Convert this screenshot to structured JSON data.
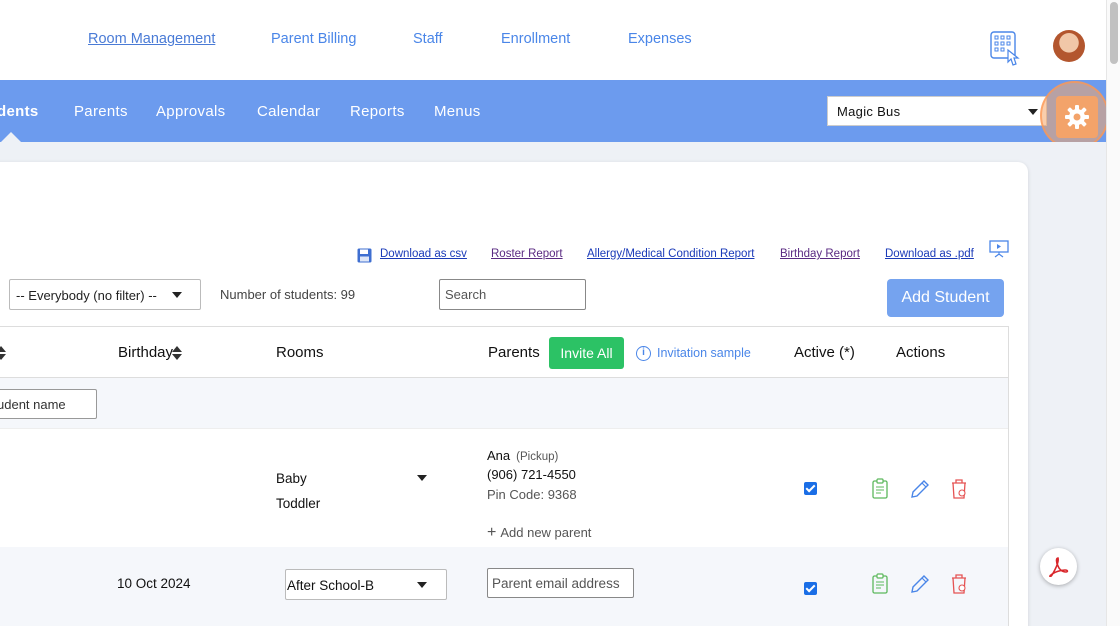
{
  "topnav": {
    "links": [
      "Room Management",
      "Parent Billing",
      "Staff",
      "Enrollment",
      "Expenses"
    ]
  },
  "bluebar": {
    "tabs": [
      "dents",
      "Parents",
      "Approvals",
      "Calendar",
      "Reports",
      "Menus"
    ],
    "center_select": "Magic Bus"
  },
  "reports": {
    "download_csv": "Download as csv",
    "roster": "Roster Report",
    "allergy": "Allergy/Medical Condition Report",
    "birthday": "Birthday Report",
    "download_pdf": "Download as .pdf"
  },
  "controls": {
    "filter_value": "-- Everybody (no filter) --",
    "student_count": "Number of students: 99",
    "search_placeholder": "Search",
    "add_student": "Add Student"
  },
  "table": {
    "headers": {
      "birthday": "Birthday",
      "rooms": "Rooms",
      "parents": "Parents",
      "invite_all": "Invite All",
      "invitation_sample": "Invitation sample",
      "active": "Active (*)",
      "actions": "Actions"
    },
    "name_filter_placeholder": "udent name",
    "rows": [
      {
        "birthday": "",
        "rooms": [
          "Baby",
          "Toddler"
        ],
        "parent_name": "Ana",
        "parent_tag": "(Pickup)",
        "parent_phone": "(906) 721-4550",
        "parent_pin": "Pin Code: 9368",
        "add_parent": "Add new parent",
        "active": true
      },
      {
        "birthday": "10 Oct 2024",
        "room_select": "After School-B",
        "parent_email_placeholder": "Parent email address",
        "active": true
      }
    ]
  },
  "colors": {
    "blue_bar": "#6c9bee",
    "link_blue": "#4a86e8",
    "invite_green": "#2cc265",
    "gear_highlight": "#f3a36a",
    "add_button": "#75a3ef"
  }
}
